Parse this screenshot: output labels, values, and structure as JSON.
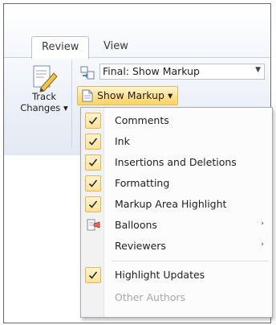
{
  "ribbon": {
    "tabs": [
      {
        "label": "Review",
        "active": true
      },
      {
        "label": "View",
        "active": false
      }
    ],
    "track_changes": {
      "line1": "Track",
      "line2": "Changes ▾",
      "icon": "track-changes-icon"
    },
    "display_for_review": {
      "value": "Final: Show Markup",
      "icon": "display-for-review-icon"
    },
    "show_markup": {
      "label": "Show Markup ▾",
      "icon": "show-markup-icon"
    }
  },
  "menu": {
    "items": [
      {
        "label": "Comments",
        "checked": true,
        "enabled": true
      },
      {
        "label": "Ink",
        "checked": true,
        "enabled": true
      },
      {
        "label": "Insertions and Deletions",
        "checked": true,
        "enabled": true
      },
      {
        "label": "Formatting",
        "checked": true,
        "enabled": true
      },
      {
        "label": "Markup Area Highlight",
        "checked": true,
        "enabled": true
      },
      {
        "label": "Balloons",
        "checked": false,
        "enabled": true,
        "submenu": true,
        "icon": "balloons-icon"
      },
      {
        "label": "Reviewers",
        "checked": false,
        "enabled": true,
        "submenu": true
      },
      {
        "label": "Highlight Updates",
        "checked": true,
        "enabled": true
      },
      {
        "label": "Other Authors",
        "checked": false,
        "enabled": false
      }
    ],
    "submenu_glyph": "›"
  },
  "colors": {
    "highlight": "#ffe08b",
    "check_border": "#e3b55e",
    "menu_border": "#a7abb0"
  }
}
